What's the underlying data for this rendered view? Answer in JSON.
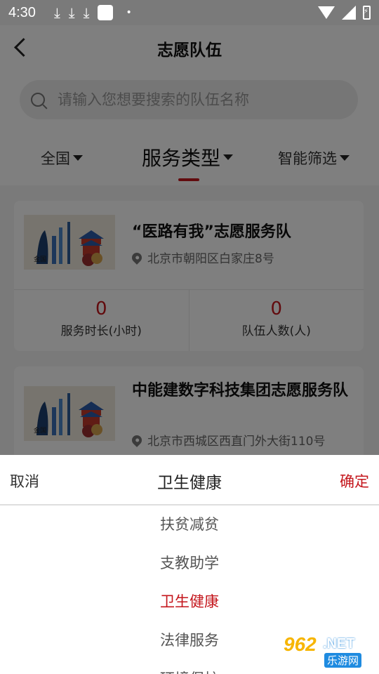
{
  "status_bar": {
    "time": "4:30",
    "download_glyph": "⤓",
    "dot": "•"
  },
  "header": {
    "title": "志愿队伍"
  },
  "search": {
    "placeholder": "请输入您想要搜索的队伍名称"
  },
  "filters": {
    "region": "全国",
    "service_type": "服务类型",
    "smart": "智能筛选"
  },
  "teams": [
    {
      "name": "“医路有我”志愿服务队",
      "address": "北京市朝阳区白家庄8号",
      "hours": "0",
      "hours_label": "服务时长(小时)",
      "members": "0",
      "members_label": "队伍人数(人)"
    },
    {
      "name": "中能建数字科技集团志愿服务队",
      "address": "北京市西城区西直门外大街110号"
    }
  ],
  "picker": {
    "cancel": "取消",
    "title": "卫生健康",
    "confirm": "确定",
    "options": [
      "扶贫减贫",
      "支教助学",
      "卫生健康",
      "法律服务",
      "环境保护"
    ],
    "selected_index": 2
  },
  "watermark": {
    "num": "962",
    "net": ".NET",
    "sub": "乐游网"
  },
  "colors": {
    "accent": "#c4161c"
  }
}
